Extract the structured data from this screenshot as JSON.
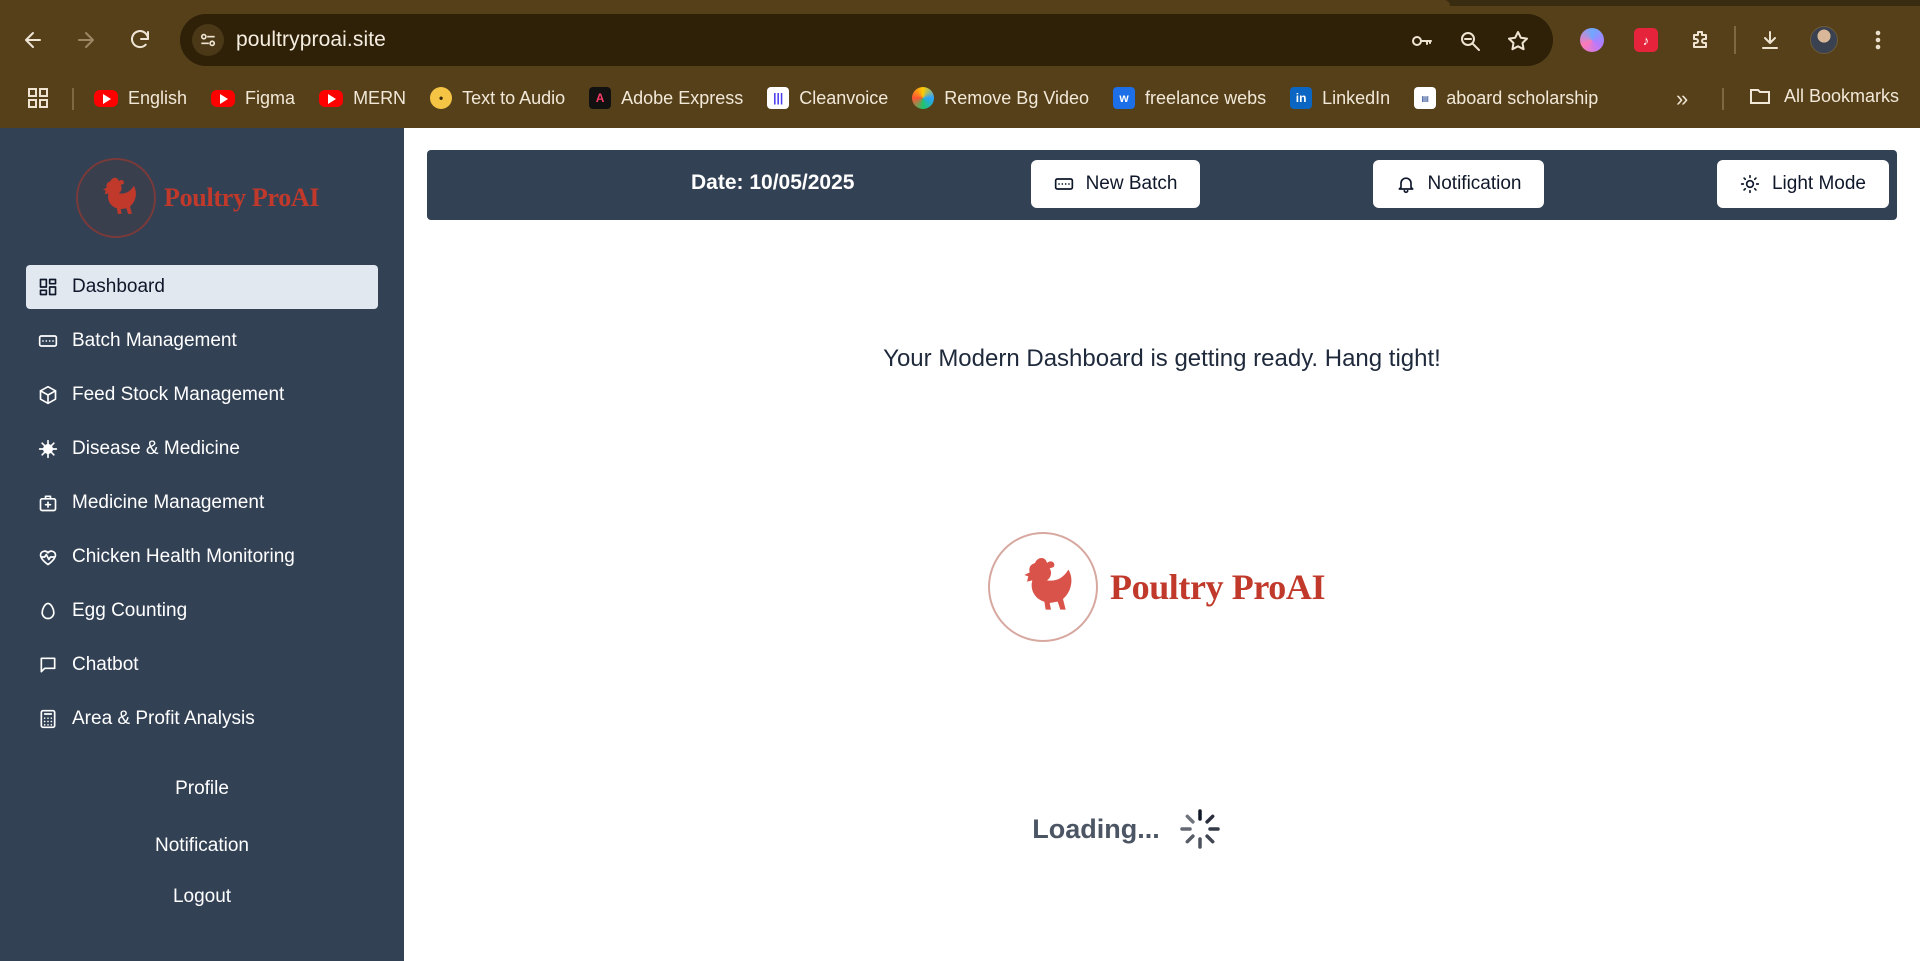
{
  "browser": {
    "url": "poultryproai.site",
    "bookmarks": [
      {
        "label": "English",
        "icon": "youtube-icon"
      },
      {
        "label": "Figma",
        "icon": "youtube-icon"
      },
      {
        "label": "MERN",
        "icon": "youtube-icon"
      },
      {
        "label": "Text to Audio",
        "icon": "text-to-audio-icon"
      },
      {
        "label": "Adobe Express",
        "icon": "adobe-express-icon"
      },
      {
        "label": "Cleanvoice",
        "icon": "cleanvoice-icon"
      },
      {
        "label": "Remove Bg Video",
        "icon": "remove-bg-icon"
      },
      {
        "label": "freelance webs",
        "icon": "freelance-icon"
      },
      {
        "label": "LinkedIn",
        "icon": "linkedin-icon"
      },
      {
        "label": "aboard scholarship",
        "icon": "scholarship-icon"
      }
    ],
    "more_glyph": "»",
    "all_bookmarks_label": "All Bookmarks"
  },
  "sidebar": {
    "brand_name": "Poultry ProAI",
    "items": [
      {
        "label": "Dashboard",
        "icon": "dashboard-icon",
        "active": true
      },
      {
        "label": "Batch Management",
        "icon": "batch-icon",
        "active": false
      },
      {
        "label": "Feed Stock Management",
        "icon": "box-icon",
        "active": false
      },
      {
        "label": "Disease & Medicine",
        "icon": "virus-icon",
        "active": false
      },
      {
        "label": "Medicine Management",
        "icon": "medkit-icon",
        "active": false
      },
      {
        "label": "Chicken Health Monitoring",
        "icon": "heart-pulse-icon",
        "active": false
      },
      {
        "label": "Egg Counting",
        "icon": "egg-icon",
        "active": false
      },
      {
        "label": "Chatbot",
        "icon": "chat-icon",
        "active": false
      },
      {
        "label": "Area & Profit Analysis",
        "icon": "calculator-icon",
        "active": false
      }
    ],
    "footer_links": [
      "Profile",
      "Notification",
      "Logout"
    ]
  },
  "topbar": {
    "date_text": "Date: 10/05/2025",
    "new_batch_label": "New Batch",
    "notification_label": "Notification",
    "light_mode_label": "Light Mode"
  },
  "main": {
    "ready_message": "Your Modern Dashboard is getting ready. Hang tight!",
    "logo_name": "Poultry ProAI",
    "loading_text": "Loading..."
  },
  "colors": {
    "sidebar_bg": "#334155",
    "brand_red": "#c0392b",
    "browser_frame": "#55401a"
  }
}
